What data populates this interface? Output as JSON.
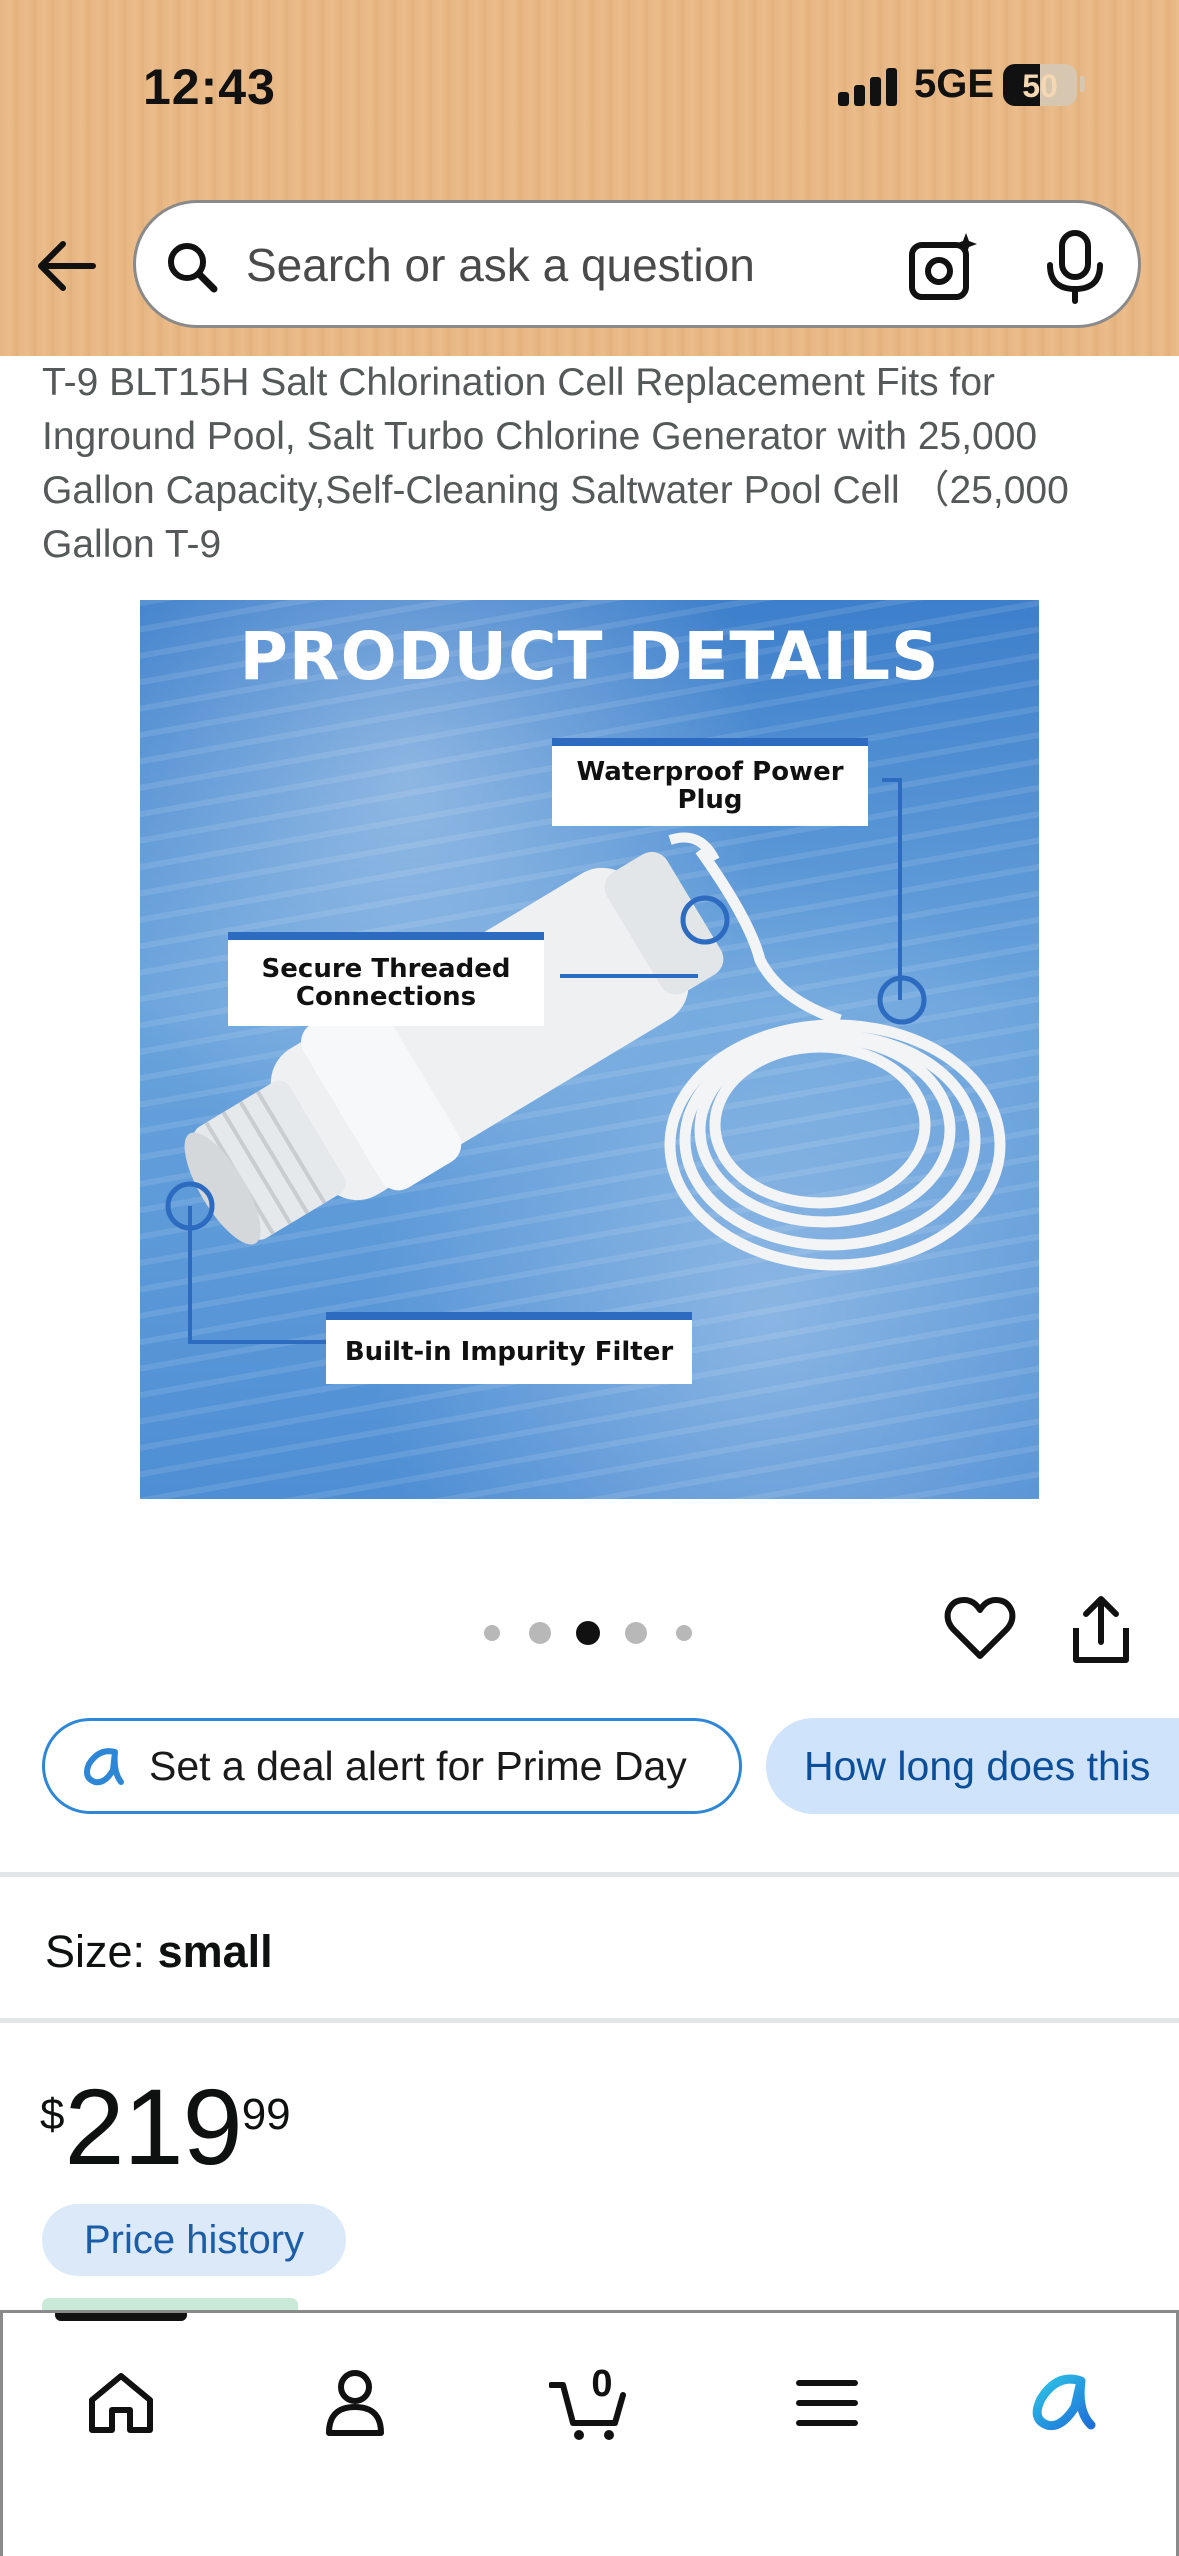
{
  "status_bar": {
    "time": "12:43",
    "network": "5GE",
    "battery": "50",
    "battery_level": 0.5
  },
  "search": {
    "placeholder": "Search or ask a question"
  },
  "product": {
    "title": "T-9 BLT15H Salt Chlorination Cell Replacement Fits for Inground Pool, Salt Turbo Chlorine Generator with 25,000 Gallon Capacity,Self-Cleaning Saltwater Pool Cell （25,000 Gallon T-9",
    "image": {
      "heading": "PRODUCT DETAILS",
      "callouts": {
        "power_plug": "Waterproof Power Plug",
        "threaded": "Secure Threaded Connections",
        "filter": "Built-in Impurity Filter"
      }
    },
    "carousel": {
      "count": 5,
      "active_index": 2
    }
  },
  "chips": {
    "deal_alert": "Set a deal alert for Prime Day",
    "question": "How long does this"
  },
  "size": {
    "label": "Size:",
    "value": "small"
  },
  "price": {
    "symbol": "$",
    "whole": "219",
    "fraction": "99",
    "history_label": "Price history"
  },
  "bottom_nav": {
    "cart_count": "0",
    "items": [
      "home-icon",
      "profile-icon",
      "cart-icon",
      "menu-icon",
      "rufus-icon"
    ]
  },
  "colors": {
    "header_bg": "#e6b683",
    "accent_blue": "#2e87d6",
    "chip_question_bg": "#cfe3fb",
    "price_history_bg": "#dbe9f9"
  }
}
